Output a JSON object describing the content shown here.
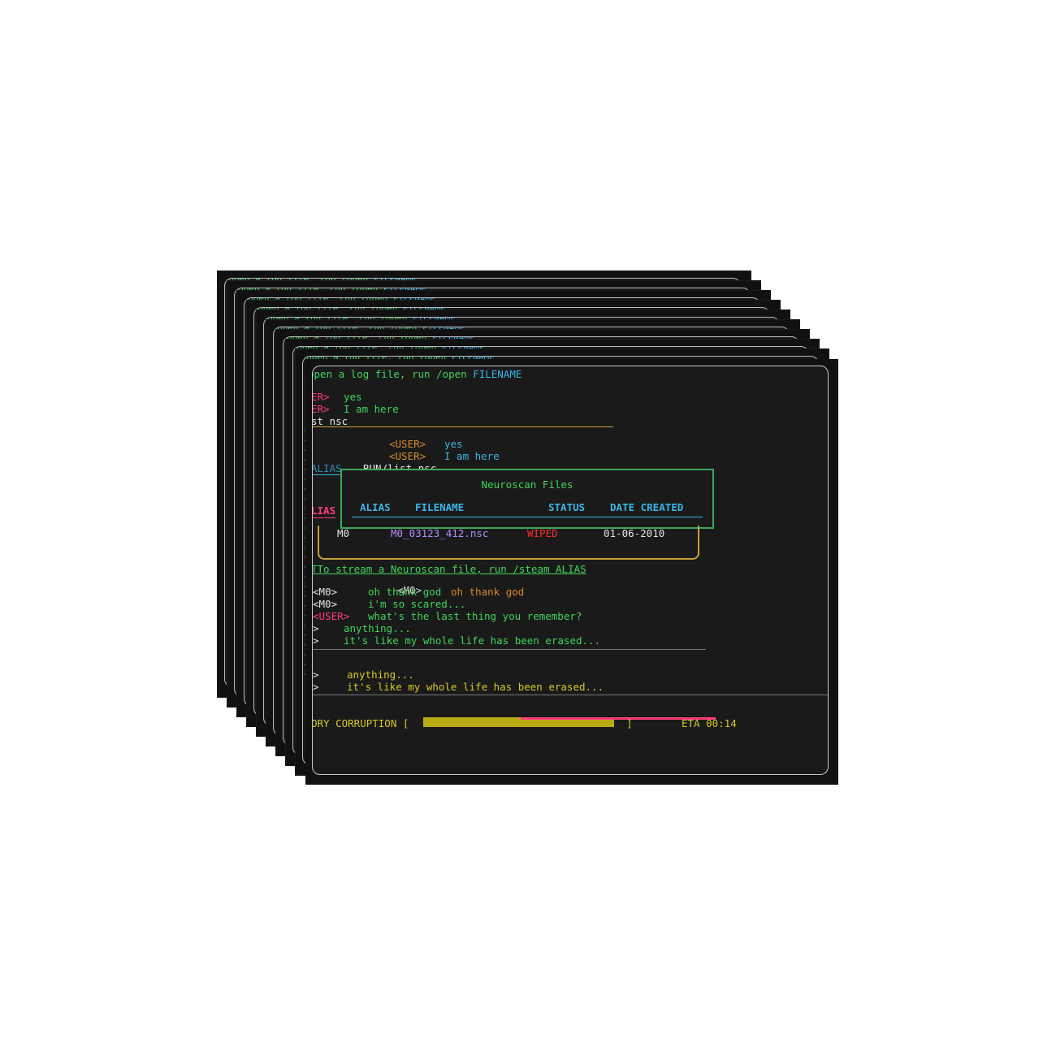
{
  "terminal": {
    "open_hint_prefix": "open a log file, run /open ",
    "open_hint_arg": "FILENAME",
    "user_tag_a": "ER>",
    "user_tag_b": "ER>",
    "line_yes": "yes",
    "line_here": "I am here",
    "cmd_fragment": "st_nsc",
    "user_tag": "<USER>",
    "echo_yes": "yes",
    "echo_here": "I am here",
    "alias_fragment": "ALIAS",
    "run_cmd": "RUN/list_nsc",
    "modal": {
      "title": "Neuroscan Files",
      "headers": [
        "ALIAS",
        "FILENAME",
        "STATUS",
        "DATE CREATED"
      ]
    },
    "left_alias": "LIAS",
    "file_row": {
      "alias": "M0",
      "filename": "M0_03123_412.nsc",
      "status": "WIPED",
      "date": "01-06-2010"
    },
    "stream_hint": "TTo stream a Neuroscan file, run /steam ALIAS",
    "chat": [
      {
        "tag": "<M0>",
        "text": "oh thank god"
      },
      {
        "tag": "<M0>",
        "text": "i'm so scared..."
      },
      {
        "tag": "<USER>",
        "text": "what's the last thing you remember?"
      },
      {
        "tag": ">",
        "text": "anything..."
      },
      {
        "tag": ">",
        "text": "it's like my whole life has been erased..."
      }
    ],
    "echo_tag": "<M0>",
    "echo_text": "oh thank god",
    "glitch_lines": [
      {
        "tag": ">",
        "text": "anything..."
      },
      {
        "tag": ">",
        "text": "it's like my whole life has been erased..."
      }
    ],
    "status_label": "ORY CORRUPTION [",
    "status_close": "]",
    "eta": "ETA 00:14",
    "corruption_progress": 0.98
  },
  "colors": {
    "green": "#3fd65a",
    "cyan": "#3ab4e6",
    "pink": "#ff3c7a",
    "yellow": "#d7c829",
    "red": "#ff2c2c",
    "background": "#1a1a1a"
  }
}
